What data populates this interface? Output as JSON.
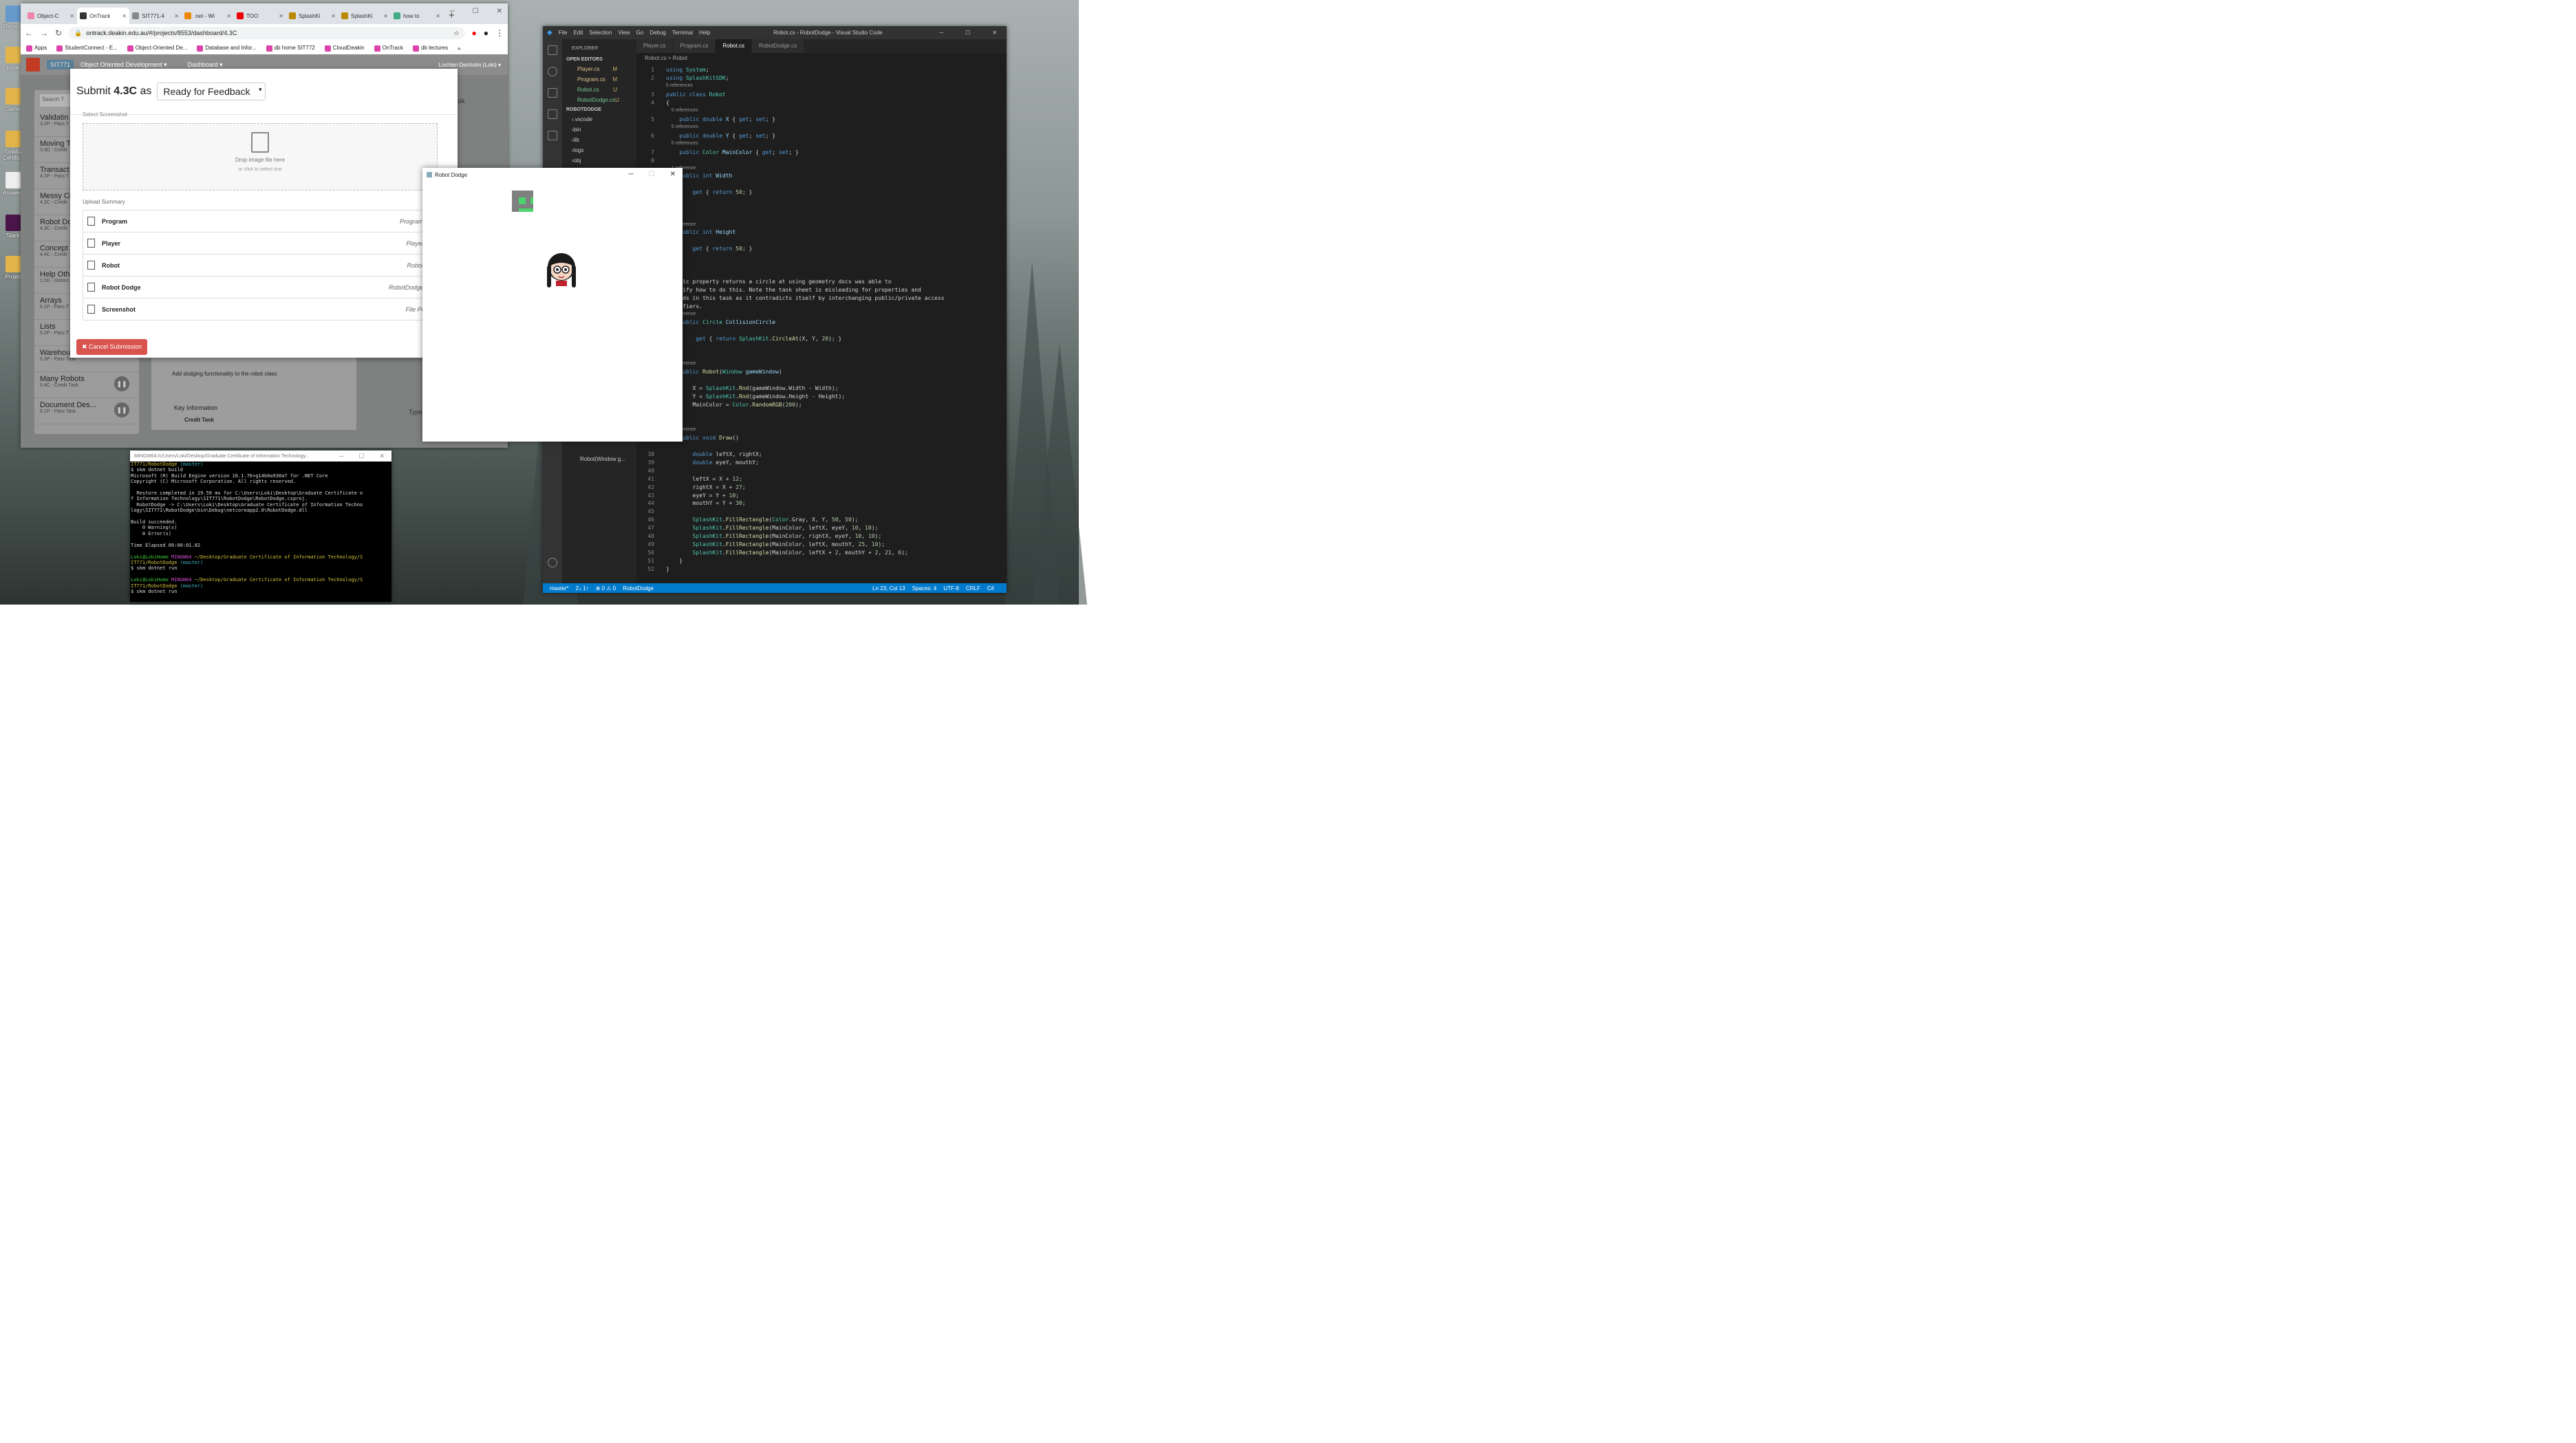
{
  "desktop": {
    "icons": [
      "Recycle",
      "Book",
      "Game",
      "Gradu Certifica",
      "Answers",
      "Slack",
      "Projec"
    ]
  },
  "chrome": {
    "tabs": [
      {
        "label": "Object-C",
        "color": "#e8a"
      },
      {
        "label": "OnTrack",
        "color": "#333"
      },
      {
        "label": "SIT771-4",
        "color": "#888"
      },
      {
        "label": ".net - Wi",
        "color": "#e80"
      },
      {
        "label": "TOO",
        "color": "#e00"
      },
      {
        "label": "SplashKi",
        "color": "#b80"
      },
      {
        "label": "SplashKi",
        "color": "#b80"
      },
      {
        "label": "how to",
        "color": "#4a8"
      }
    ],
    "url": "ontrack.deakin.edu.au/#/projects/8553/dashboard/4.3C",
    "bookmarks": [
      "Apps",
      "StudentConnect - E...",
      "Object-Oriented De...",
      "Database and Infor...",
      "db home  SIT772",
      "CloudDeakin",
      "OnTrack",
      "db lectures"
    ],
    "ontrack": {
      "unit_code": "SIT771",
      "unit_name": "Object Oriented Development ▾",
      "dashboard": "Dashboard ▾",
      "user": "Lochlan Denholm (Loki) ▾",
      "search_placeholder": "Search T",
      "tasks": [
        {
          "title": "Validatin",
          "sub": "3.2P - Pass T"
        },
        {
          "title": "Moving T",
          "sub": "3.3C - Credit"
        },
        {
          "title": "Transact",
          "sub": "4.1P - Pass T"
        },
        {
          "title": "Messy Cl",
          "sub": "4.2C - Credit"
        },
        {
          "title": "Robot Do",
          "sub": "4.3C - Credit"
        },
        {
          "title": "Concept",
          "sub": "4.4C - Credit"
        },
        {
          "title": "Help Oth",
          "sub": "1.5D - Distinc"
        },
        {
          "title": "Arrays",
          "sub": "5.1P - Pass T"
        },
        {
          "title": "Lists",
          "sub": "5.2P - Pass T"
        },
        {
          "title": "Warehou",
          "sub": "5.3P - Pass Task"
        },
        {
          "title": "Many Robots",
          "sub": "5.4C - Credit Task"
        },
        {
          "title": "Document Des...",
          "sub": "6.1P - Pass Task"
        }
      ],
      "task_desc": "Add dodging functionality to the robot class",
      "key_info": "Key Information",
      "credit_task": "Credit Task",
      "side_label": "ask",
      "type_files": "Type files..."
    },
    "modal": {
      "title_prefix": "Submit ",
      "task": "4.3C",
      "title_suffix": " as",
      "status": "Ready for Feedback",
      "select_screenshot": "Select Screenshot",
      "drop_title": "Drop image file here",
      "drop_sub": "or click to select one",
      "summary_label": "Upload Summary",
      "rows": [
        {
          "name": "Program",
          "file": "Program.cs"
        },
        {
          "name": "Player",
          "file": "Player.cs"
        },
        {
          "name": "Robot",
          "file": "Robot.cs"
        },
        {
          "name": "Robot Dodge",
          "file": "RobotDodge.cs"
        },
        {
          "name": "Screenshot",
          "file": "File Penc"
        }
      ],
      "cancel": "✖ Cancel Submission"
    }
  },
  "vscode": {
    "menu": [
      "File",
      "Edit",
      "Selection",
      "View",
      "Go",
      "Debug",
      "Terminal",
      "Help"
    ],
    "title": "Robot.cs - RobotDodge - Visual Studio Code",
    "explorer": "EXPLORER",
    "open_editors": "OPEN EDITORS",
    "project": "ROBOTDODGE",
    "open_files": [
      {
        "name": "Player.cs",
        "mark": "M"
      },
      {
        "name": "Program.cs",
        "mark": "M"
      },
      {
        "name": "Robot.cs",
        "mark": "U"
      },
      {
        "name": "RobotDodge.cs",
        "mark": "U"
      }
    ],
    "folders": [
      ".vscode",
      "bin",
      "lib",
      "logs",
      "obj",
      "Resources"
    ],
    "outline_item": "Robot(Window g...",
    "tabs": [
      "Player.cs",
      "Program.cs",
      "Robot.cs",
      "RobotDodge.cs"
    ],
    "breadcrumb": "Robot.cs > Robot",
    "status": {
      "branch": "master*",
      "sync": "2↓ 1↑",
      "problems": "⊗ 0 ⚠ 0",
      "project": "RobotDodge",
      "pos": "Ln 23, Col 13",
      "spaces": "Spaces: 4",
      "enc": "UTF-8",
      "eol": "CRLF",
      "lang": "C#"
    }
  },
  "robotdodge": {
    "title": "Robot Dodge"
  },
  "terminal": {
    "title": "MINGW64:/c/Users/Loki/Desktop/Graduate Certificate of Information Technology..."
  },
  "colors": {
    "accent": "#007acc",
    "danger": "#d9534f",
    "robot": "#808080",
    "robot_face": "#4cd36b"
  }
}
